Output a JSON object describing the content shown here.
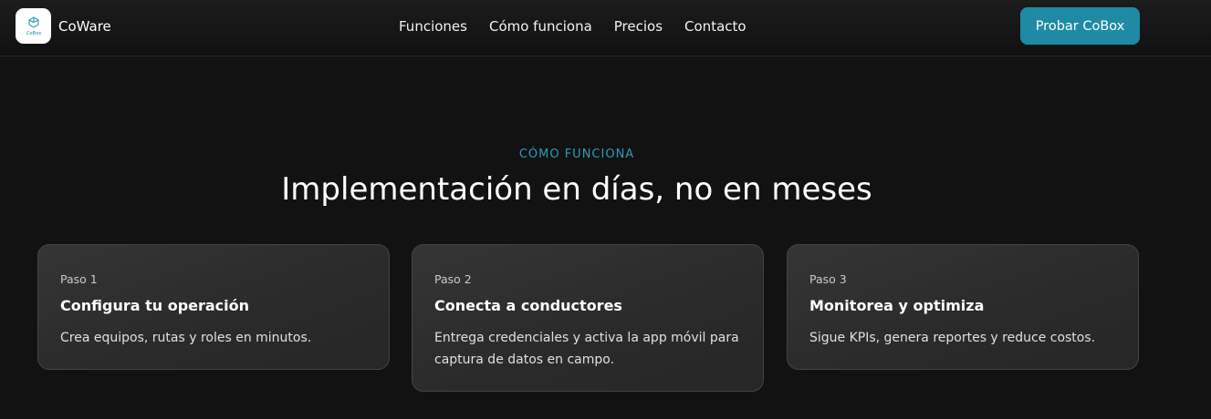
{
  "header": {
    "brand": "CoWare",
    "logo_text": "CoBox",
    "nav": [
      "Funciones",
      "Cómo funciona",
      "Precios",
      "Contacto"
    ],
    "cta_label": "Probar CoBox"
  },
  "section": {
    "eyebrow": "CÓMO FUNCIONA",
    "title": "Implementación en días, no en meses"
  },
  "steps": [
    {
      "label": "Paso 1",
      "title": "Configura tu operación",
      "desc": "Crea equipos, rutas y roles en minutos."
    },
    {
      "label": "Paso 2",
      "title": "Conecta a conductores",
      "desc": "Entrega credenciales y activa la app móvil para captura de datos en campo."
    },
    {
      "label": "Paso 3",
      "title": "Monitorea y optimiza",
      "desc": "Sigue KPIs, genera reportes y reduce costos."
    }
  ],
  "colors": {
    "accent": "#1e8aa3",
    "eyebrow": "#2b9cb8",
    "background": "#121212"
  }
}
